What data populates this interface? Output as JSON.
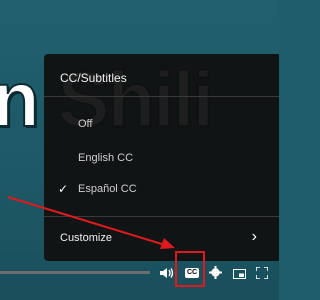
{
  "video": {
    "title_fragment": "n Shili"
  },
  "captions_menu": {
    "header": "CC/Subtitles",
    "options": [
      {
        "label": "Off",
        "selected": false
      },
      {
        "label": "English CC",
        "selected": false
      },
      {
        "label": "Español CC",
        "selected": true
      }
    ],
    "customize_label": "Customize",
    "checkmark": "✓",
    "chevron": "›"
  },
  "controls": {
    "cc_label": "CC",
    "icons": [
      "volume-icon",
      "cc-icon",
      "gear-icon",
      "picture-in-picture-icon",
      "fullscreen-icon"
    ]
  },
  "annotation": {
    "highlight_color": "#e0191e"
  }
}
